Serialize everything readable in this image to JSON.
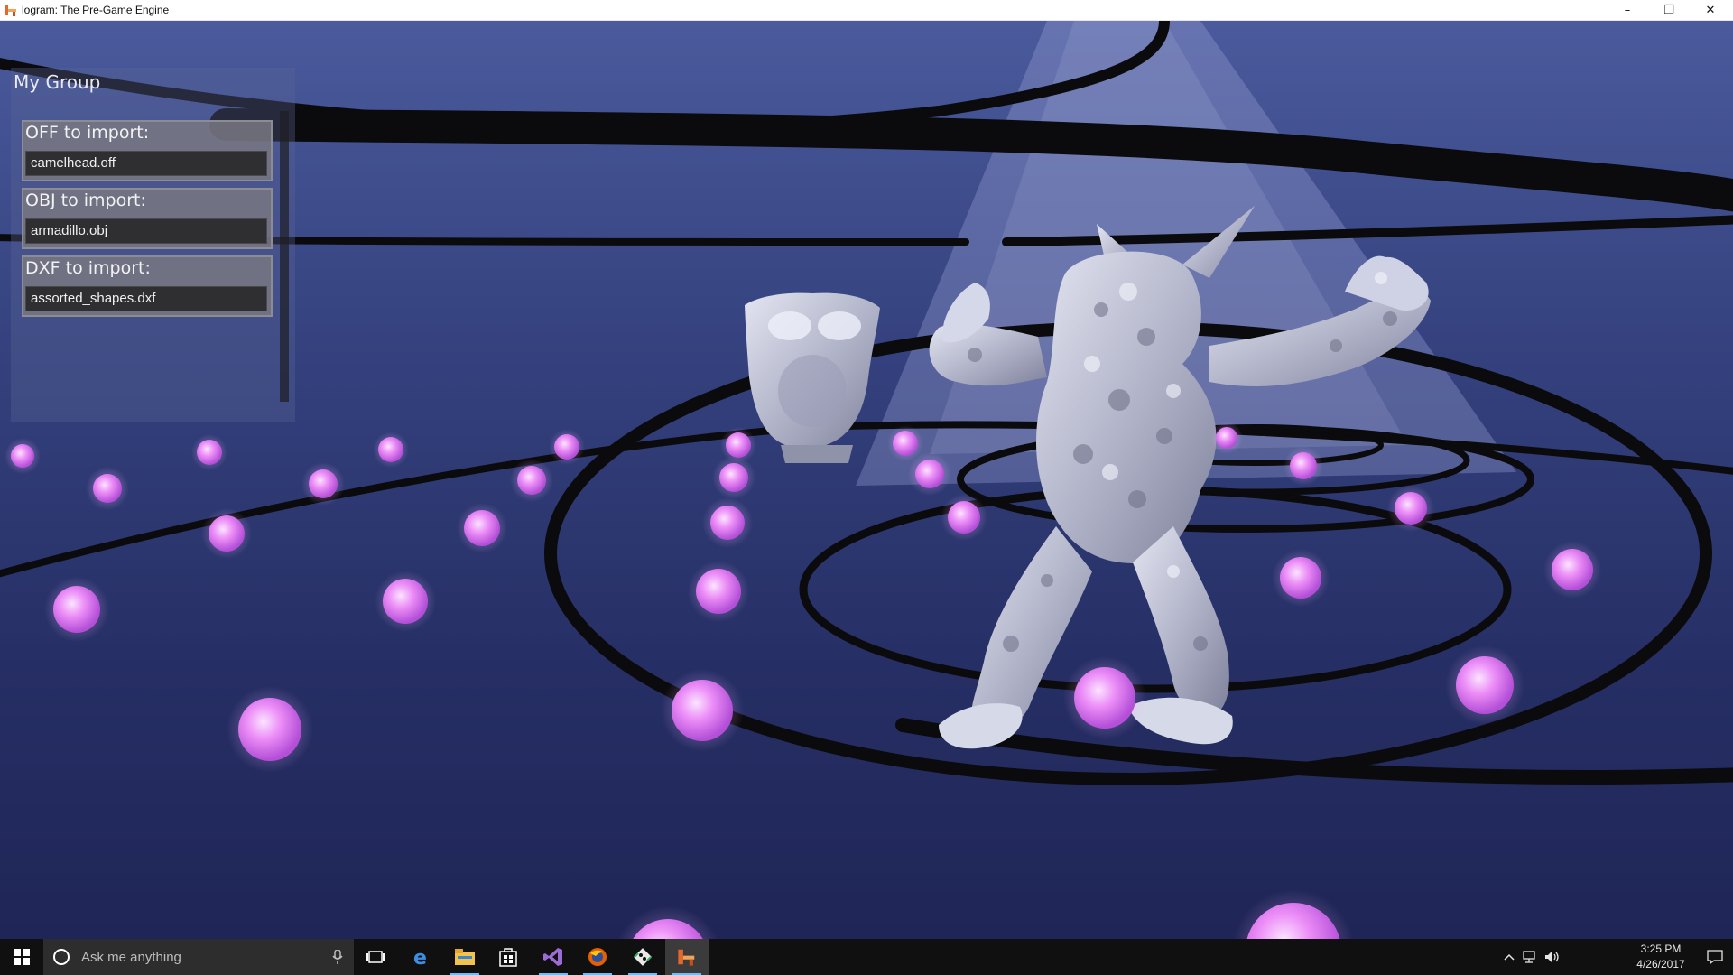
{
  "window": {
    "title": "logram: The Pre-Game Engine",
    "minimize_glyph": "–",
    "restore_glyph": "❐",
    "close_glyph": "✕"
  },
  "panel": {
    "title": "My Group",
    "fields": [
      {
        "label": "OFF to import:",
        "value": "camelhead.off"
      },
      {
        "label": "OBJ to import:",
        "value": "armadillo.obj"
      },
      {
        "label": "DXF to import:",
        "value": "assorted_shapes.dxf"
      }
    ]
  },
  "scene": {
    "background_top": "#4a5a9c",
    "background_bottom": "#1f2556",
    "sphere_color": "#e07cf5",
    "ring_color": "#0b0b0d",
    "model_color": "#c9cbdc",
    "models": [
      "camelhead-model",
      "armadillo-model"
    ]
  },
  "taskbar": {
    "search_placeholder": "Ask me anything",
    "apps": [
      "task-view-icon",
      "edge-icon",
      "file-explorer-icon",
      "store-icon",
      "visual-studio-icon",
      "firefox-icon",
      "git-icon",
      "logram-app-icon"
    ],
    "time": "3:25 PM",
    "date": "4/26/2017"
  }
}
